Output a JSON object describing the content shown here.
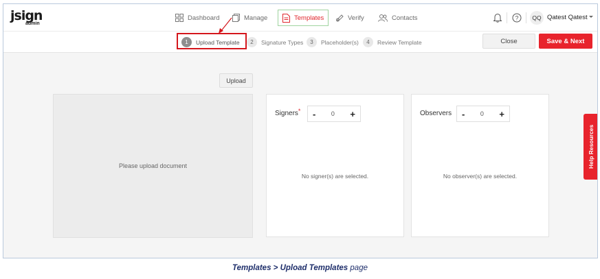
{
  "app": {
    "logo_text": "jsign",
    "logo_sub": "admin"
  },
  "nav": [
    {
      "label": "Dashboard",
      "icon": "dashboard-icon"
    },
    {
      "label": "Manage",
      "icon": "manage-icon"
    },
    {
      "label": "Templates",
      "icon": "templates-icon",
      "active": true
    },
    {
      "label": "Verify",
      "icon": "verify-icon"
    },
    {
      "label": "Contacts",
      "icon": "contacts-icon"
    }
  ],
  "user": {
    "initials": "QQ",
    "name": "Qatest Qatest"
  },
  "steps": [
    {
      "num": "1",
      "label": "Upload Template"
    },
    {
      "num": "2",
      "label": "Signature Types"
    },
    {
      "num": "3",
      "label": "Placeholder(s)"
    },
    {
      "num": "4",
      "label": "Review Template"
    }
  ],
  "buttons": {
    "close": "Close",
    "save_next": "Save & Next",
    "upload": "Upload"
  },
  "document": {
    "placeholder": "Please upload document"
  },
  "signers": {
    "title": "Signers",
    "required_mark": "*",
    "minus": "-",
    "plus": "+",
    "count": "0",
    "empty": "No signer(s) are selected."
  },
  "observers": {
    "title": "Observers",
    "minus": "-",
    "plus": "+",
    "count": "0",
    "empty": "No observer(s) are selected."
  },
  "help": {
    "label": "Help Resources"
  },
  "caption": {
    "part1": "Templates > Upload Templates",
    "part2": " page"
  },
  "colors": {
    "accent": "#e8232c",
    "highlight_box": "#d4161c",
    "active_nav_border": "#9fd39f",
    "caption": "#1f2f6b"
  }
}
